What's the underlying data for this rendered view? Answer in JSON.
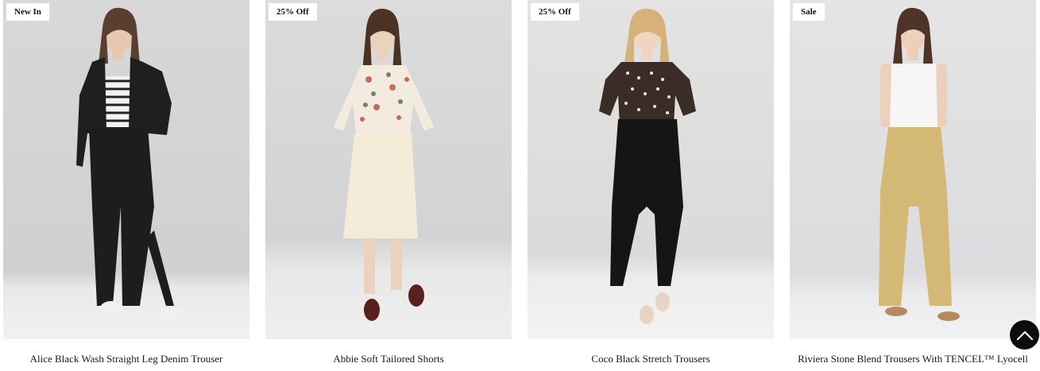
{
  "products": [
    {
      "badge": "New In",
      "title": "Alice Black Wash Straight Leg Denim Trouser"
    },
    {
      "badge": "25% Off",
      "title": "Abbie Soft Tailored Shorts"
    },
    {
      "badge": "25% Off",
      "title": "Coco Black Stretch Trousers"
    },
    {
      "badge": "Sale",
      "title": "Riviera Stone Blend Trousers With TENCEL™ Lyocell"
    }
  ],
  "back_to_top": {
    "icon": "chevron-up-icon"
  },
  "colors": {
    "badge_bg": "#ffffff",
    "back_to_top_bg": "#0d0d0d"
  }
}
